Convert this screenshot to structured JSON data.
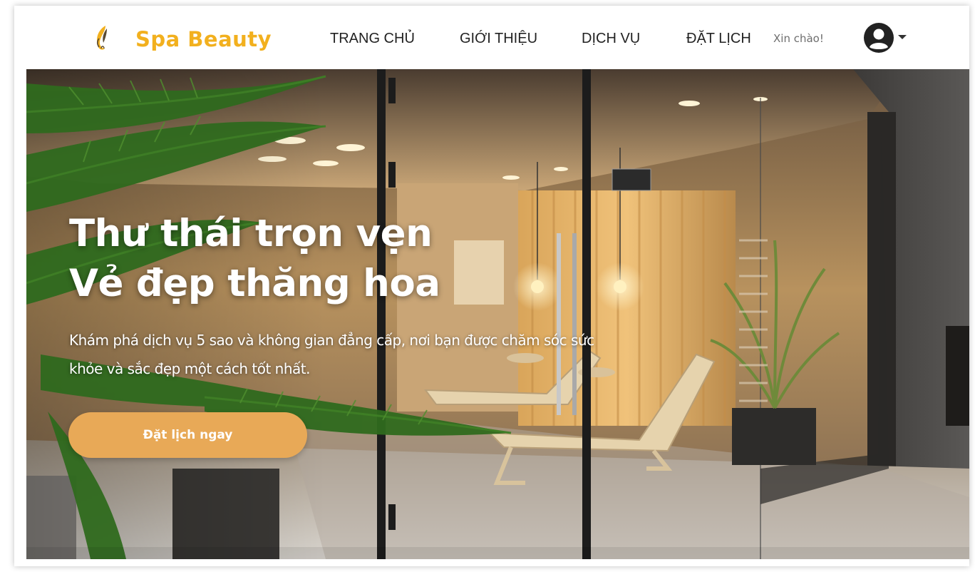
{
  "brand": {
    "name": "Spa Beauty",
    "logo_icon": "feather-logo-icon",
    "color": "#f2b01e"
  },
  "nav": {
    "items": [
      {
        "label": "TRANG CHỦ"
      },
      {
        "label": "GIỚI THIỆU"
      },
      {
        "label": "DỊCH VỤ"
      },
      {
        "label": "ĐẶT LỊCH"
      }
    ],
    "greeting": "Xin chào!",
    "user_icon": "user-avatar-icon",
    "dropdown_icon": "caret-down-icon"
  },
  "hero": {
    "title_line1": "Thư thái trọn vẹn",
    "title_line2": "Vẻ đẹp thăng hoa",
    "subtitle": "Khám phá dịch vụ 5 sao và không gian đẳng cấp, nơi bạn được chăm sóc sức khỏe và sắc đẹp một cách tốt nhất.",
    "cta_label": "Đặt lịch ngay",
    "cta_color": "#e8a957"
  }
}
